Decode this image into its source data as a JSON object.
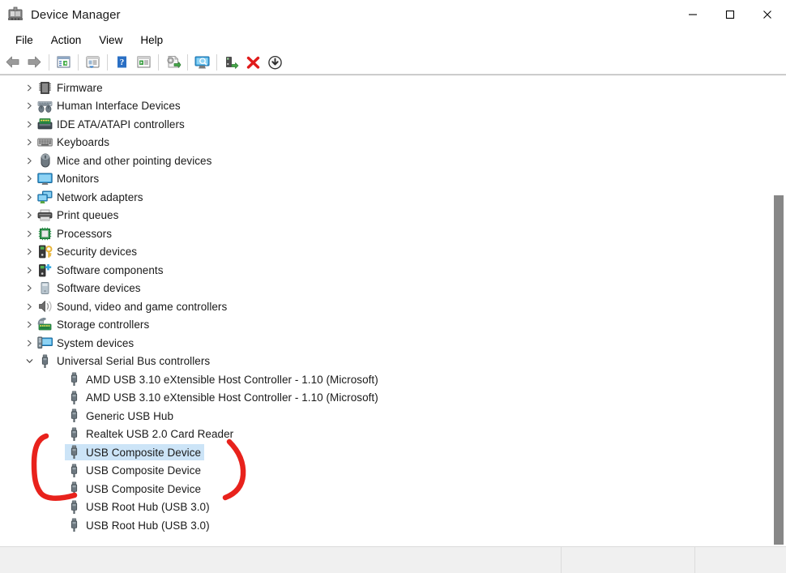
{
  "window": {
    "title": "Device Manager",
    "app_icon": "device-manager-icon",
    "controls": {
      "minimize": "minimize-icon",
      "maximize": "maximize-icon",
      "close": "close-icon"
    }
  },
  "menubar": {
    "items": [
      {
        "label": "File"
      },
      {
        "label": "Action"
      },
      {
        "label": "View"
      },
      {
        "label": "Help"
      }
    ]
  },
  "toolbar": {
    "buttons": [
      {
        "name": "back-icon",
        "tip": "Back"
      },
      {
        "name": "forward-icon",
        "tip": "Forward"
      },
      {
        "sep": true
      },
      {
        "name": "properties-icon",
        "tip": "Properties"
      },
      {
        "sep": true
      },
      {
        "name": "show-hide-console-tree-icon",
        "tip": "Show/Hide Console Tree"
      },
      {
        "sep": true
      },
      {
        "name": "help-icon",
        "tip": "Help"
      },
      {
        "name": "update-driver-icon",
        "tip": "Update Driver"
      },
      {
        "sep": true
      },
      {
        "name": "scan-for-hardware-changes-icon",
        "tip": "Scan for hardware changes"
      },
      {
        "sep": true
      },
      {
        "name": "display-icon",
        "tip": "Display"
      },
      {
        "sep": true
      },
      {
        "name": "enable-device-icon",
        "tip": "Enable device"
      },
      {
        "name": "uninstall-device-icon",
        "tip": "Uninstall device"
      },
      {
        "name": "disable-device-icon",
        "tip": "Disable device"
      }
    ]
  },
  "tree": {
    "nodes": [
      {
        "label": "Firmware",
        "icon": "firmware-icon",
        "level": 1,
        "expanded": false,
        "has_children": true,
        "selected": false
      },
      {
        "label": "Human Interface Devices",
        "icon": "hid-icon",
        "level": 1,
        "expanded": false,
        "has_children": true,
        "selected": false
      },
      {
        "label": "IDE ATA/ATAPI controllers",
        "icon": "ide-controller-icon",
        "level": 1,
        "expanded": false,
        "has_children": true,
        "selected": false
      },
      {
        "label": "Keyboards",
        "icon": "keyboard-icon",
        "level": 1,
        "expanded": false,
        "has_children": true,
        "selected": false
      },
      {
        "label": "Mice and other pointing devices",
        "icon": "mouse-icon",
        "level": 1,
        "expanded": false,
        "has_children": true,
        "selected": false
      },
      {
        "label": "Monitors",
        "icon": "monitor-icon",
        "level": 1,
        "expanded": false,
        "has_children": true,
        "selected": false
      },
      {
        "label": "Network adapters",
        "icon": "network-adapter-icon",
        "level": 1,
        "expanded": false,
        "has_children": true,
        "selected": false
      },
      {
        "label": "Print queues",
        "icon": "printer-icon",
        "level": 1,
        "expanded": false,
        "has_children": true,
        "selected": false
      },
      {
        "label": "Processors",
        "icon": "processor-icon",
        "level": 1,
        "expanded": false,
        "has_children": true,
        "selected": false
      },
      {
        "label": "Security devices",
        "icon": "security-device-icon",
        "level": 1,
        "expanded": false,
        "has_children": true,
        "selected": false
      },
      {
        "label": "Software components",
        "icon": "software-component-icon",
        "level": 1,
        "expanded": false,
        "has_children": true,
        "selected": false
      },
      {
        "label": "Software devices",
        "icon": "software-device-icon",
        "level": 1,
        "expanded": false,
        "has_children": true,
        "selected": false
      },
      {
        "label": "Sound, video and game controllers",
        "icon": "sound-icon",
        "level": 1,
        "expanded": false,
        "has_children": true,
        "selected": false
      },
      {
        "label": "Storage controllers",
        "icon": "storage-controller-icon",
        "level": 1,
        "expanded": false,
        "has_children": true,
        "selected": false
      },
      {
        "label": "System devices",
        "icon": "system-device-icon",
        "level": 1,
        "expanded": false,
        "has_children": true,
        "selected": false
      },
      {
        "label": "Universal Serial Bus controllers",
        "icon": "usb-icon",
        "level": 1,
        "expanded": true,
        "has_children": true,
        "selected": false
      },
      {
        "label": "AMD USB 3.10 eXtensible Host Controller - 1.10 (Microsoft)",
        "icon": "usb-icon",
        "level": 2,
        "expanded": false,
        "has_children": false,
        "selected": false
      },
      {
        "label": "AMD USB 3.10 eXtensible Host Controller - 1.10 (Microsoft)",
        "icon": "usb-icon",
        "level": 2,
        "expanded": false,
        "has_children": false,
        "selected": false
      },
      {
        "label": "Generic USB Hub",
        "icon": "usb-icon",
        "level": 2,
        "expanded": false,
        "has_children": false,
        "selected": false
      },
      {
        "label": "Realtek USB 2.0 Card Reader",
        "icon": "usb-icon",
        "level": 2,
        "expanded": false,
        "has_children": false,
        "selected": false
      },
      {
        "label": "USB Composite Device",
        "icon": "usb-icon",
        "level": 2,
        "expanded": false,
        "has_children": false,
        "selected": true
      },
      {
        "label": "USB Composite Device",
        "icon": "usb-icon",
        "level": 2,
        "expanded": false,
        "has_children": false,
        "selected": false
      },
      {
        "label": "USB Composite Device",
        "icon": "usb-icon",
        "level": 2,
        "expanded": false,
        "has_children": false,
        "selected": false
      },
      {
        "label": "USB Root Hub (USB 3.0)",
        "icon": "usb-icon",
        "level": 2,
        "expanded": false,
        "has_children": false,
        "selected": false
      },
      {
        "label": "USB Root Hub (USB 3.0)",
        "icon": "usb-icon",
        "level": 2,
        "expanded": false,
        "has_children": false,
        "selected": false
      }
    ]
  },
  "annotation": {
    "color": "#e8221c",
    "shapes": [
      {
        "name": "left-bracket",
        "kind": "hand-drawn-bracket"
      },
      {
        "name": "right-bracket",
        "kind": "hand-drawn-bracket"
      }
    ]
  },
  "statusbar": {
    "cells": [
      "",
      "",
      ""
    ]
  },
  "colors": {
    "selection": "#cce4f7",
    "annotation_red": "#e8221c",
    "scrollbar_thumb": "#878787",
    "text": "#1a1a1a"
  }
}
